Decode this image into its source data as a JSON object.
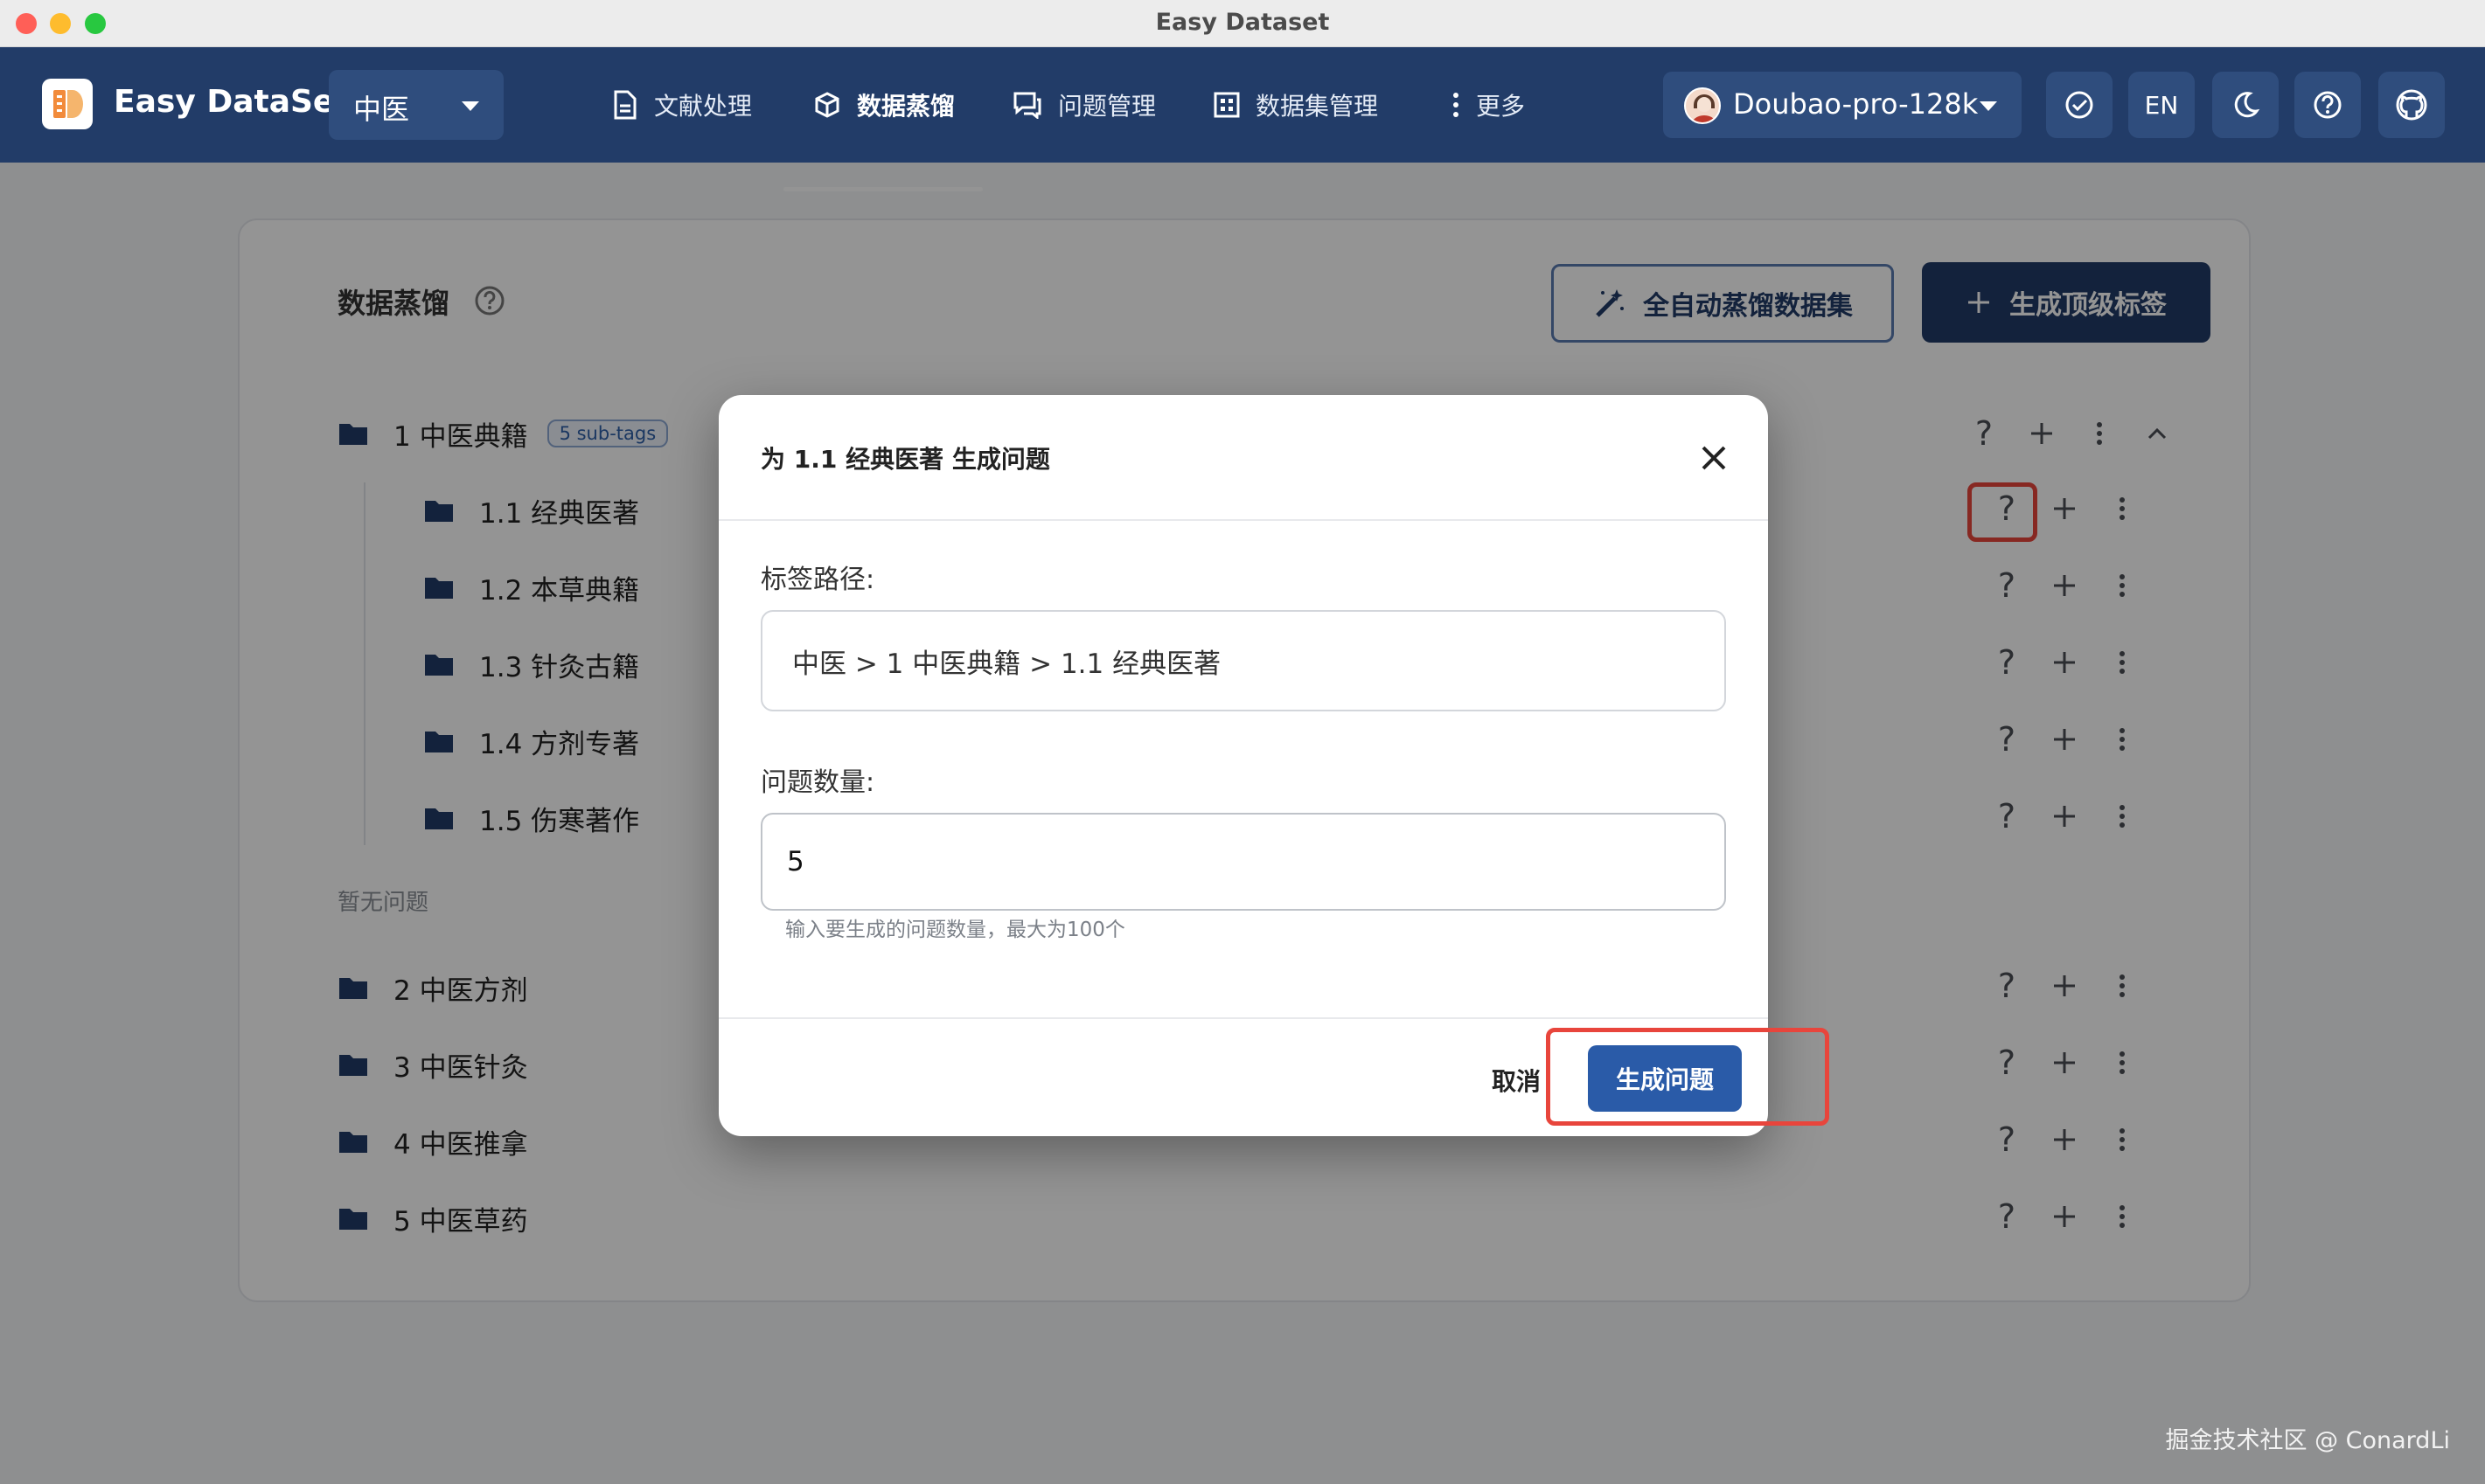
{
  "window": {
    "title": "Easy Dataset"
  },
  "header": {
    "brand": "Easy DataSet",
    "project": "中医",
    "nav": [
      {
        "label": "文献处理",
        "icon": "document-icon",
        "active": false
      },
      {
        "label": "数据蒸馏",
        "icon": "cube-icon",
        "active": true
      },
      {
        "label": "问题管理",
        "icon": "chat-icon",
        "active": false
      },
      {
        "label": "数据集管理",
        "icon": "grid-icon",
        "active": false
      },
      {
        "label": "更多",
        "icon": "more-vertical-icon",
        "active": false
      }
    ],
    "model": "Doubao-pro-128k",
    "lang": "EN"
  },
  "page": {
    "title": "数据蒸馏",
    "auto_button": "全自动蒸馏数据集",
    "top_tag_button": "生成顶级标签",
    "root": {
      "label": "1 中医典籍",
      "badge": "5 sub-tags"
    },
    "children": [
      "1.1 经典医著",
      "1.2 本草典籍",
      "1.3 针灸古籍",
      "1.4 方剂专著",
      "1.5 伤寒著作"
    ],
    "empty_text": "暂无问题",
    "others": [
      "2 中医方剂",
      "3 中医针灸",
      "4 中医推拿",
      "5 中医草药"
    ],
    "action_question": "?"
  },
  "dialog": {
    "title": "为 1.1 经典医著 生成问题",
    "path_label": "标签路径:",
    "path_value": "中医 > 1 中医典籍 > 1.1 经典医著",
    "count_label": "问题数量:",
    "count_value": "5",
    "hint": "输入要生成的问题数量，最大为100个",
    "cancel": "取消",
    "submit": "生成问题"
  },
  "watermark": "掘金技术社区 @ ConardLi",
  "colors": {
    "header": "#223c68",
    "primary": "#2a5ba8",
    "highlight": "#e8453c"
  }
}
